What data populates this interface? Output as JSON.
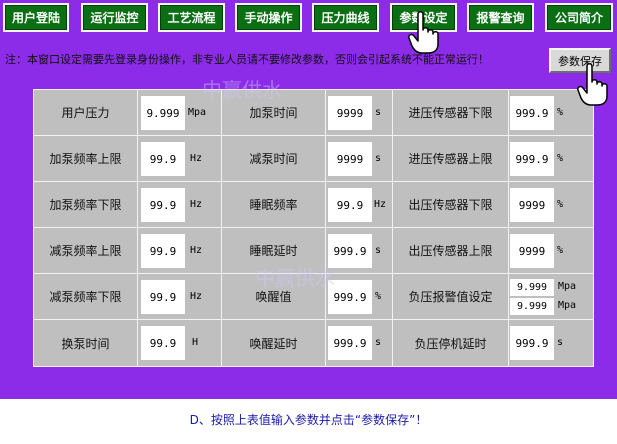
{
  "nav": [
    {
      "label": "用户登陆"
    },
    {
      "label": "运行监控"
    },
    {
      "label": "工艺流程"
    },
    {
      "label": "手动操作"
    },
    {
      "label": "压力曲线"
    },
    {
      "label": "参数设定"
    },
    {
      "label": "报警查询"
    },
    {
      "label": "公司简介"
    }
  ],
  "notice": "注：本窗口设定需要先登录身份操作，非专业人员请不要修改参数，否则会引起系统不能正常运行！",
  "save_button": "参数保存",
  "watermark": "中赢供水",
  "rows": [
    {
      "c1": {
        "label": "用户压力",
        "value": "9.999",
        "unit": "Mpa"
      },
      "c2": {
        "label": "加泵时间",
        "value": "9999",
        "unit": "s"
      },
      "c3": {
        "label": "进压传感器下限",
        "value": "999.9",
        "unit": "%"
      }
    },
    {
      "c1": {
        "label": "加泵频率上限",
        "value": "99.9",
        "unit": "Hz"
      },
      "c2": {
        "label": "减泵时间",
        "value": "9999",
        "unit": "s"
      },
      "c3": {
        "label": "进压传感器上限",
        "value": "999.9",
        "unit": "%"
      }
    },
    {
      "c1": {
        "label": "加泵频率下限",
        "value": "99.9",
        "unit": "Hz"
      },
      "c2": {
        "label": "睡眠频率",
        "value": "99.9",
        "unit": "Hz"
      },
      "c3": {
        "label": "出压传感器下限",
        "value": "9999",
        "unit": "%"
      }
    },
    {
      "c1": {
        "label": "减泵频率上限",
        "value": "99.9",
        "unit": "Hz"
      },
      "c2": {
        "label": "睡眠延时",
        "value": "999.9",
        "unit": "s"
      },
      "c3": {
        "label": "出压传感器上限",
        "value": "9999",
        "unit": "%"
      }
    },
    {
      "c1": {
        "label": "减泵频率下限",
        "value": "99.9",
        "unit": "Hz"
      },
      "c2": {
        "label": "唤醒值",
        "value": "999.9",
        "unit": "%"
      },
      "c3": {
        "label": "负压报警值设定",
        "value1": "9.999",
        "unit1": "Mpa",
        "value2": "9.999",
        "unit2": "Mpa"
      }
    },
    {
      "c1": {
        "label": "换泵时间",
        "value": "99.9",
        "unit": "H"
      },
      "c2": {
        "label": "唤醒延时",
        "value": "999.9",
        "unit": "s"
      },
      "c3": {
        "label": "负压停机延时",
        "value": "999.9",
        "unit": "s"
      }
    }
  ],
  "caption": "D、按照上表值输入参数并点击“参数保存”！"
}
